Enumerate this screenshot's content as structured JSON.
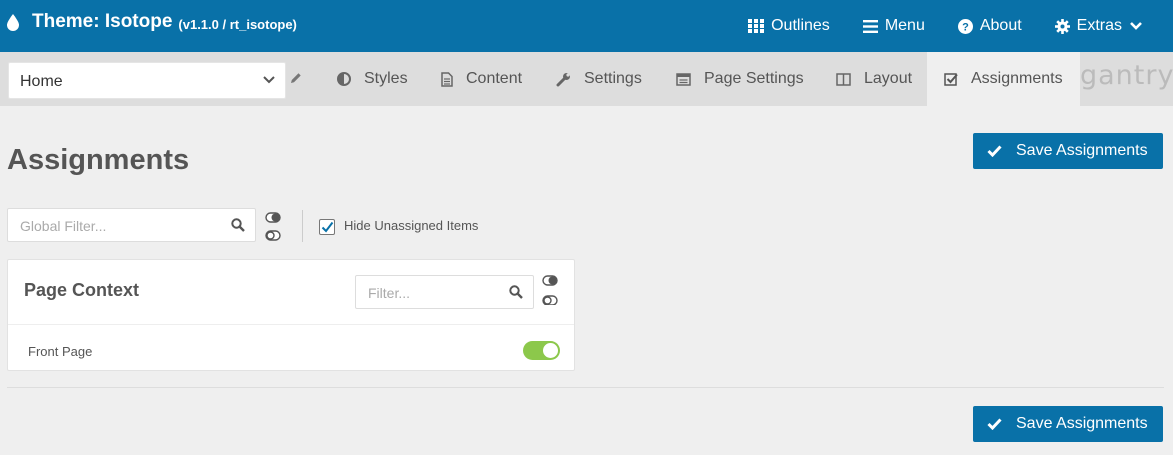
{
  "header": {
    "title": "Theme: Isotope",
    "version": "(v1.1.0 / rt_isotope)",
    "nav": {
      "outlines": "Outlines",
      "menu": "Menu",
      "about": "About",
      "extras": "Extras"
    }
  },
  "subnav": {
    "outline_selected": "Home",
    "tabs": [
      "Styles",
      "Content",
      "Settings",
      "Page Settings",
      "Layout",
      "Assignments"
    ],
    "active_tab": "Assignments",
    "logo_text": "gantry"
  },
  "main": {
    "title": "Assignments",
    "save_label": "Save Assignments",
    "global_filter_placeholder": "Global Filter...",
    "hide_unassigned_label": "Hide Unassigned Items",
    "hide_unassigned_checked": true
  },
  "card": {
    "title": "Page Context",
    "filter_placeholder": "Filter...",
    "items": [
      {
        "label": "Front Page",
        "enabled": true
      }
    ]
  },
  "colors": {
    "brand": "#0971a8",
    "toggle_on": "#8cc84b"
  }
}
